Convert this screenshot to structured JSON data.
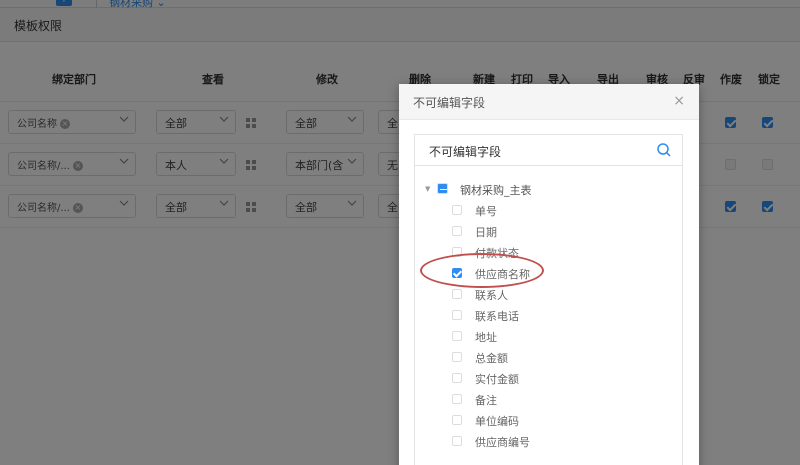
{
  "topbar": {
    "add_label": "+",
    "tab_label": "钢材采购 ⌄"
  },
  "page": {
    "title": "模板权限"
  },
  "table": {
    "headers": {
      "dept": "绑定部门",
      "view": "查看",
      "edit": "修改",
      "del": "删除",
      "create": "新建",
      "print": "打印",
      "import": "导入",
      "export": "导出",
      "audit": "审核",
      "unaudit": "反审",
      "void": "作废",
      "lock": "锁定"
    },
    "rows": [
      {
        "dept": "公司名称",
        "view": "全部",
        "edit": "全部",
        "del": "全",
        "void": true,
        "lock": true,
        "disabled": false
      },
      {
        "dept": "公司名称/...",
        "view": "本人",
        "edit": "本部门(含",
        "del": "无",
        "void": false,
        "lock": false,
        "disabled": true
      },
      {
        "dept": "公司名称/...",
        "view": "全部",
        "edit": "全部",
        "del": "全",
        "void": true,
        "lock": true,
        "disabled": false
      }
    ]
  },
  "modal": {
    "title": "不可编辑字段",
    "close": "×",
    "search_value": "不可编辑字段",
    "root_label": "钢材采购_主表",
    "items": [
      {
        "label": "单号",
        "checked": false
      },
      {
        "label": "日期",
        "checked": false
      },
      {
        "label": "付款状态",
        "checked": false
      },
      {
        "label": "供应商名称",
        "checked": true
      },
      {
        "label": "联系人",
        "checked": false
      },
      {
        "label": "联系电话",
        "checked": false
      },
      {
        "label": "地址",
        "checked": false
      },
      {
        "label": "总金额",
        "checked": false
      },
      {
        "label": "实付金额",
        "checked": false
      },
      {
        "label": "备注",
        "checked": false
      },
      {
        "label": "单位编码",
        "checked": false
      },
      {
        "label": "供应商编号",
        "checked": false
      }
    ]
  },
  "colors": {
    "accent": "#2f8cf0",
    "annotation": "#c0504d"
  }
}
